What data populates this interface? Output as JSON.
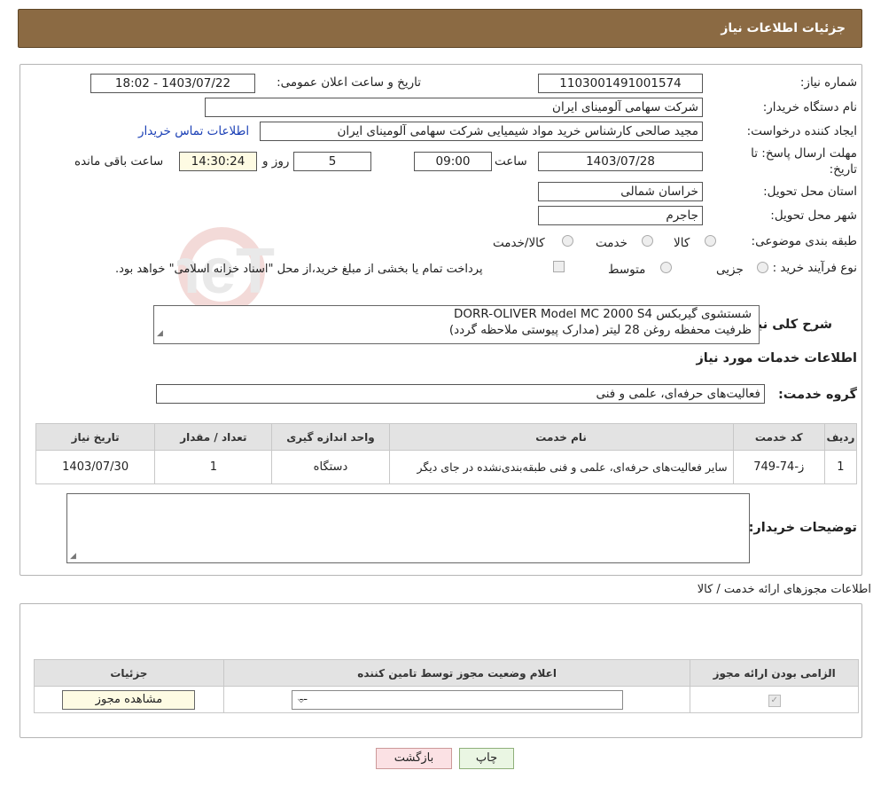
{
  "header": {
    "title": "جزئیات اطلاعات نیاز"
  },
  "fields": {
    "need_number_label": "شماره نیاز:",
    "need_number": "1103001491001574",
    "announce_label": "تاریخ و ساعت اعلان عمومی:",
    "announce_value": "1403/07/22 - 18:02",
    "buyer_org_label": "نام دستگاه خریدار:",
    "buyer_org": "شرکت سهامی آلومینای ایران",
    "creator_label": "ایجاد کننده درخواست:",
    "creator": "مجید صالحی کارشناس خرید مواد شیمیایی شرکت سهامی آلومینای ایران",
    "contact_link": "اطلاعات تماس خریدار",
    "deadline_label_1": "مهلت ارسال پاسخ: تا",
    "deadline_label_2": "تاریخ:",
    "deadline_date": "1403/07/28",
    "time_label": "ساعت",
    "deadline_time": "09:00",
    "days_value": "5",
    "days_label": "روز و",
    "remaining_time": "14:30:24",
    "remaining_label": "ساعت باقی مانده",
    "province_label": "استان محل تحویل:",
    "province": "خراسان شمالی",
    "city_label": "شهر محل تحویل:",
    "city": "جاجرم",
    "category_label": "طبقه بندی موضوعی:",
    "category_options": [
      "کالا",
      "خدمت",
      "کالا/خدمت"
    ],
    "process_label": "نوع فرآیند خرید :",
    "process_options": [
      "جزیی",
      "متوسط"
    ],
    "payment_note": "پرداخت تمام یا بخشی از مبلغ خرید،از محل \"اسناد خزانه اسلامی\" خواهد بود."
  },
  "description": {
    "label": "شرح کلی نیاز:",
    "line1": "شستشوی گیربکس DORR-OLIVER Model MC 2000 S4",
    "line2": "ظرفیت محفظه روغن 28 لیتر (مدارک پیوستی ملاحظه گردد)"
  },
  "services": {
    "section_title": "اطلاعات خدمات مورد نیاز",
    "group_label": "گروه خدمت:",
    "group_value": "فعالیت‌های حرفه‌ای، علمی و فنی",
    "columns": [
      "ردیف",
      "کد خدمت",
      "نام خدمت",
      "واحد اندازه گیری",
      "تعداد / مقدار",
      "تاریخ نیاز"
    ],
    "rows": [
      {
        "row": "1",
        "code": "ز-74-749",
        "name": "سایر فعالیت‌های حرفه‌ای، علمی و فنی طبقه‌بندی‌نشده در جای دیگر",
        "unit": "دستگاه",
        "qty": "1",
        "date": "1403/07/30"
      }
    ]
  },
  "buyer_notes": {
    "label": "توضیحات خریدار:"
  },
  "permits": {
    "section_title": "اطلاعات مجوزهای ارائه خدمت / کالا",
    "columns": [
      "الزامی بودن ارائه مجوز",
      "اعلام وضعیت مجوز توسط تامین کننده",
      "جزئیات"
    ],
    "select_value": "--",
    "view_button": "مشاهده مجوز"
  },
  "footer": {
    "print": "چاپ",
    "back": "بازگشت"
  },
  "watermark_text": "AriaTender.neT"
}
